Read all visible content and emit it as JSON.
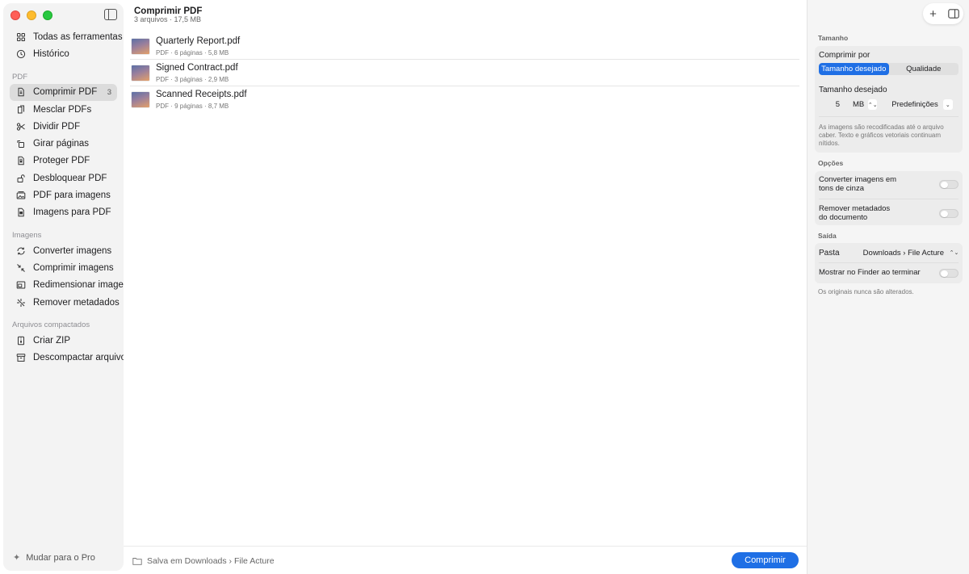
{
  "sidebar": {
    "top_items": [
      {
        "label": "Todas as ferramentas",
        "icon": "grid-icon"
      },
      {
        "label": "Histórico",
        "icon": "clock-icon"
      }
    ],
    "sections": [
      {
        "title": "PDF",
        "items": [
          {
            "label": "Comprimir PDF",
            "icon": "document-compress-icon",
            "count": "3",
            "active": true
          },
          {
            "label": "Mesclar PDFs",
            "icon": "merge-icon"
          },
          {
            "label": "Dividir PDF",
            "icon": "scissors-icon"
          },
          {
            "label": "Girar páginas",
            "icon": "rotate-icon"
          },
          {
            "label": "Proteger PDF",
            "icon": "lock-document-icon"
          },
          {
            "label": "Desbloquear PDF",
            "icon": "unlock-icon"
          },
          {
            "label": "PDF para imagens",
            "icon": "photo-stack-icon"
          },
          {
            "label": "Imagens para PDF",
            "icon": "image-document-icon"
          }
        ]
      },
      {
        "title": "Imagens",
        "items": [
          {
            "label": "Converter imagens",
            "icon": "convert-arrows-icon"
          },
          {
            "label": "Comprimir imagens",
            "icon": "compress-arrows-icon"
          },
          {
            "label": "Redimensionar imagens",
            "icon": "resize-icon"
          },
          {
            "label": "Remover metadados",
            "icon": "sparkle-remove-icon"
          }
        ]
      },
      {
        "title": "Arquivos compactados",
        "items": [
          {
            "label": "Criar ZIP",
            "icon": "zip-icon"
          },
          {
            "label": "Descompactar arquivo",
            "icon": "archive-box-icon"
          }
        ]
      }
    ],
    "footer": "Mudar para o Pro"
  },
  "main": {
    "title": "Comprimir PDF",
    "subtitle": "3 arquivos · 17,5 MB",
    "files": [
      {
        "name": "Quarterly Report.pdf",
        "meta": "PDF · 6 páginas · 5,8 MB"
      },
      {
        "name": "Signed Contract.pdf",
        "meta": "PDF · 3 páginas · 2,9 MB"
      },
      {
        "name": "Scanned Receipts.pdf",
        "meta": "PDF · 9 páginas · 8,7 MB"
      }
    ],
    "save_location": "Salva em Downloads › File Acture",
    "compress_button": "Comprimir"
  },
  "panel": {
    "size_section": "Tamanho",
    "compress_by_label": "Comprimir por",
    "segments": {
      "target": "Tamanho desejado",
      "quality": "Qualidade"
    },
    "target_size_label": "Tamanho desejado",
    "target_size_value": "5",
    "target_size_unit": "MB",
    "presets_label": "Predefinições",
    "size_help": "As imagens são recodificadas até o arquivo caber. Texto e gráficos vetoriais continuam nítidos.",
    "options_section": "Opções",
    "grayscale_label": "Converter imagens em tons de cinza",
    "grayscale_on": false,
    "metadata_label": "Remover metadados do documento",
    "metadata_on": false,
    "output_section": "Saída",
    "folder_label": "Pasta",
    "folder_value": "Downloads › File Acture",
    "finder_label": "Mostrar no Finder ao terminar",
    "finder_on": false,
    "note": "Os originais nunca são alterados."
  }
}
